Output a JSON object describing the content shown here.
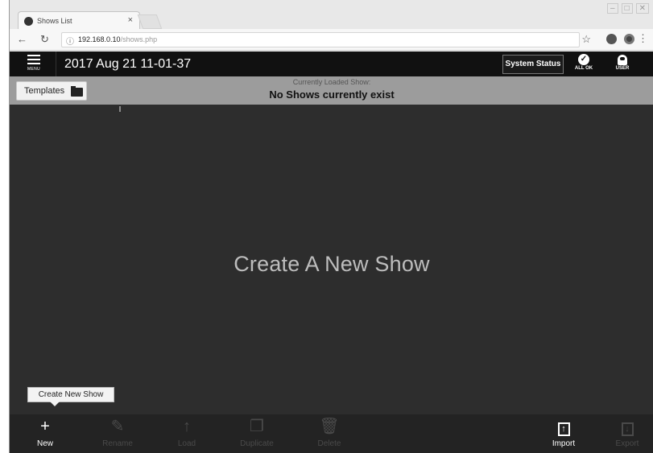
{
  "browser": {
    "tab_title": "Shows List",
    "tab_close": "×",
    "url_host": "192.168.0.10",
    "url_path": "/shows.php",
    "window_buttons": [
      "–",
      "□",
      "✕"
    ]
  },
  "appbar": {
    "menu_label": "MENU",
    "datetime": "2017 Aug 21 11-01-37",
    "system_status": "System Status",
    "status_ok_label": "ALL OK",
    "user_label": "USER"
  },
  "subbar": {
    "templates_label": "Templates",
    "loaded_label": "Currently Loaded Show:",
    "loaded_value": "No Shows currently exist"
  },
  "main": {
    "placeholder": "Create A New Show"
  },
  "tooltip": {
    "text": "Create New Show"
  },
  "toolbar": {
    "new": "New",
    "rename": "Rename",
    "load": "Load",
    "duplicate": "Duplicate",
    "delete": "Delete",
    "import": "Import",
    "export": "Export"
  },
  "colors": {
    "appbar_bg": "#111111",
    "subbar_bg": "#9c9c9c",
    "main_bg": "#2d2d2d",
    "toolbar_bg": "#232323",
    "disabled_text": "#4a4a4a"
  },
  "icons": {
    "new": "plus-icon",
    "rename": "pencil-icon",
    "load": "upload-arrow-icon",
    "duplicate": "duplicate-icon",
    "delete": "trash-icon",
    "import": "import-icon",
    "export": "export-icon"
  }
}
